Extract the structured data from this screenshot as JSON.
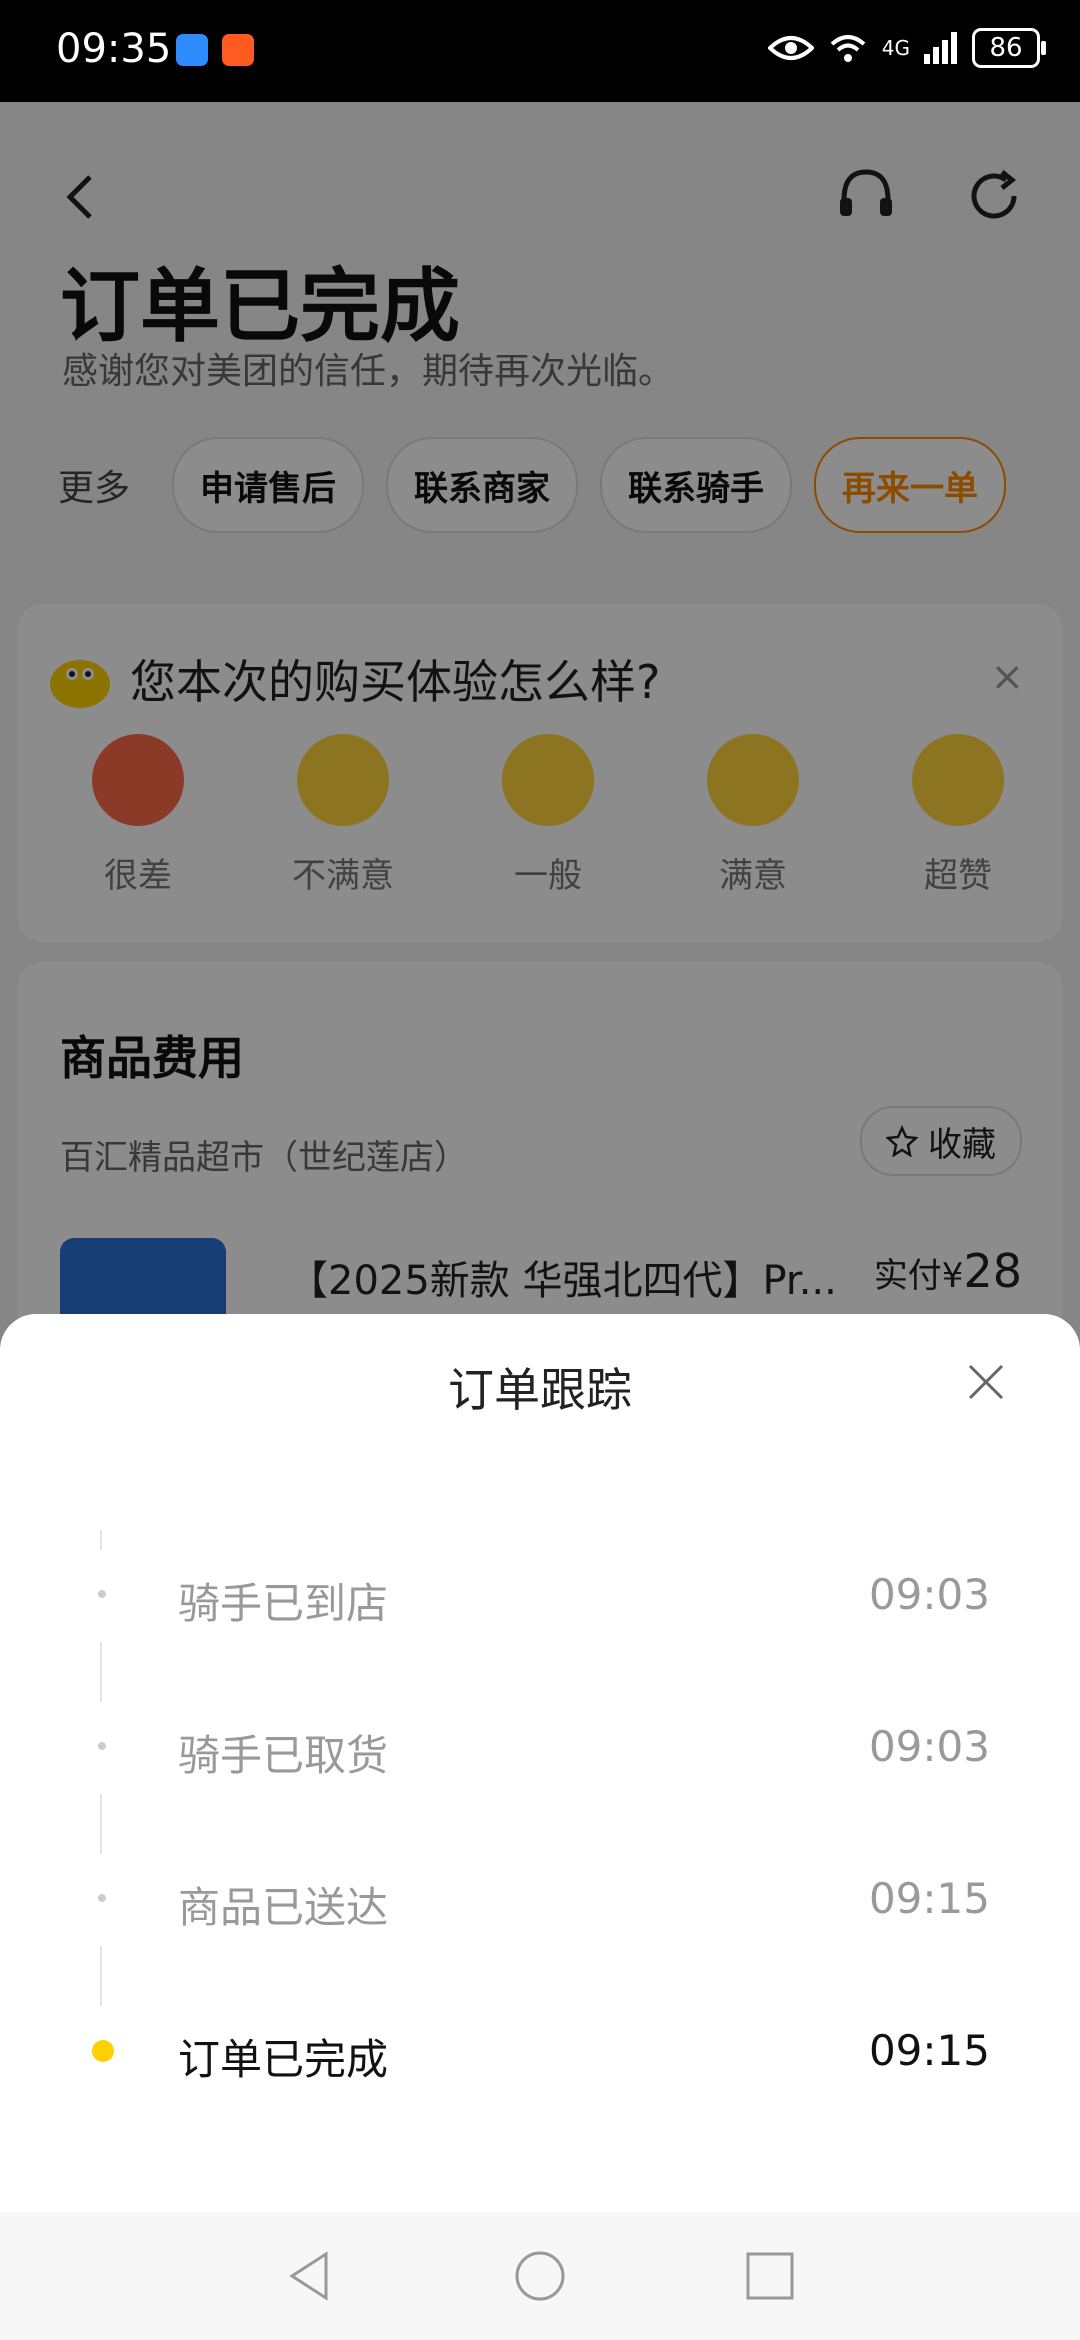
{
  "status_bar": {
    "time": "09:35",
    "network": "4G",
    "battery": "86"
  },
  "header": {
    "title": "订单已完成",
    "subtitle": "感谢您对美团的信任，期待再次光临。"
  },
  "actions": {
    "more_label": "更多",
    "buttons": [
      "申请售后",
      "联系商家",
      "联系骑手",
      "再来一单"
    ]
  },
  "rating": {
    "title": "您本次的购买体验怎么样?",
    "close": "×",
    "options": [
      "很差",
      "不满意",
      "一般",
      "满意",
      "超赞"
    ]
  },
  "goods": {
    "title": "商品费用",
    "shop_name": "百汇精品超市（世纪莲店）",
    "favorite_label": "收藏",
    "product_name": "【2025新款 华强北四代】Pr...",
    "price_prefix": "实付¥",
    "price_value": "28"
  },
  "tracking_sheet": {
    "title": "订单跟踪",
    "events": [
      {
        "label": "骑手已到店",
        "time": "09:03"
      },
      {
        "label": "骑手已取货",
        "time": "09:03"
      },
      {
        "label": "商品已送达",
        "time": "09:15"
      },
      {
        "label": "订单已完成",
        "time": "09:15"
      }
    ]
  },
  "colors": {
    "accent": "#ff8a00",
    "active_dot": "#ffd100"
  }
}
